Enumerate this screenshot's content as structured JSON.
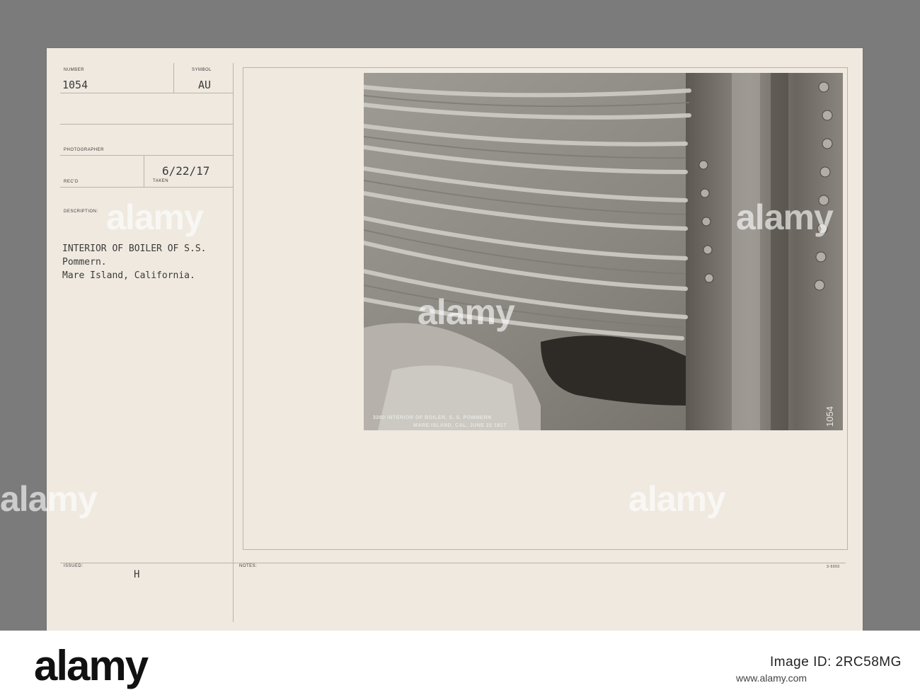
{
  "record": {
    "number_label": "NUMBER",
    "number_value": "1054",
    "symbol_label": "SYMBOL",
    "symbol_value": "AU",
    "photographer_label": "PHOTOGRAPHER",
    "recd_label": "REC'D",
    "taken_label": "TAKEN",
    "taken_value": "6/22/17",
    "description_label": "DESCRIPTION:",
    "description_lines": [
      "INTERIOR OF BOILER OF S.S.",
      "Pommern.",
      "Mare Island, California."
    ],
    "issued_label": "ISSUED:",
    "issued_value": "H",
    "notes_label": "NOTES:",
    "form_code": "3-5003"
  },
  "photo": {
    "caption_line1": "3260  INTERIOR OF BOILER,   S. S. POMMERN",
    "caption_line2": "MARE ISLAND, CAL.  JUNE 22 1917",
    "side_number": "1054"
  },
  "watermark": {
    "text": "alamy"
  },
  "footer": {
    "logo": "alamy",
    "image_id": "Image ID: 2RC58MG",
    "url": "www.alamy.com"
  }
}
